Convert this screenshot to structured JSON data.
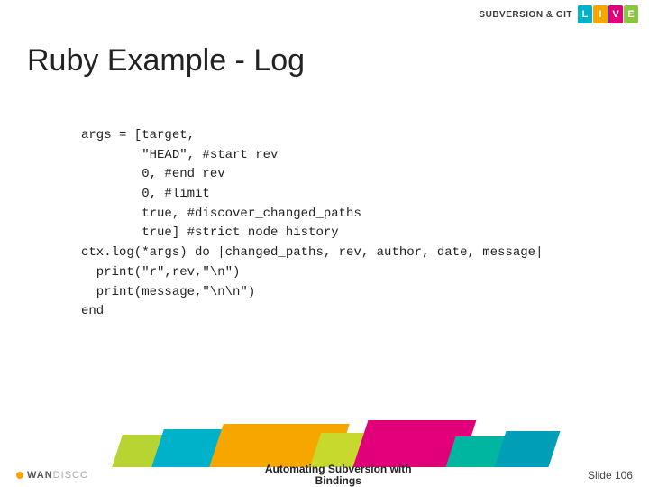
{
  "brand": {
    "text": "SUBVERSION & GIT",
    "live": [
      "L",
      "I",
      "V",
      "E"
    ]
  },
  "title": "Ruby Example - Log",
  "code": "args = [target,\n        \"HEAD\", #start rev\n        0, #end rev\n        0, #limit\n        true, #discover_changed_paths\n        true] #strict node history\nctx.log(*args) do |changed_paths, rev, author, date, message|\n  print(\"r\",rev,\"\\n\")\n  print(message,\"\\n\\n\")\nend",
  "footer": {
    "wandisco_a": "WAN",
    "wandisco_b": "DISCO",
    "center": "Automating Subversion with\nBindings",
    "slide": "Slide 106"
  }
}
